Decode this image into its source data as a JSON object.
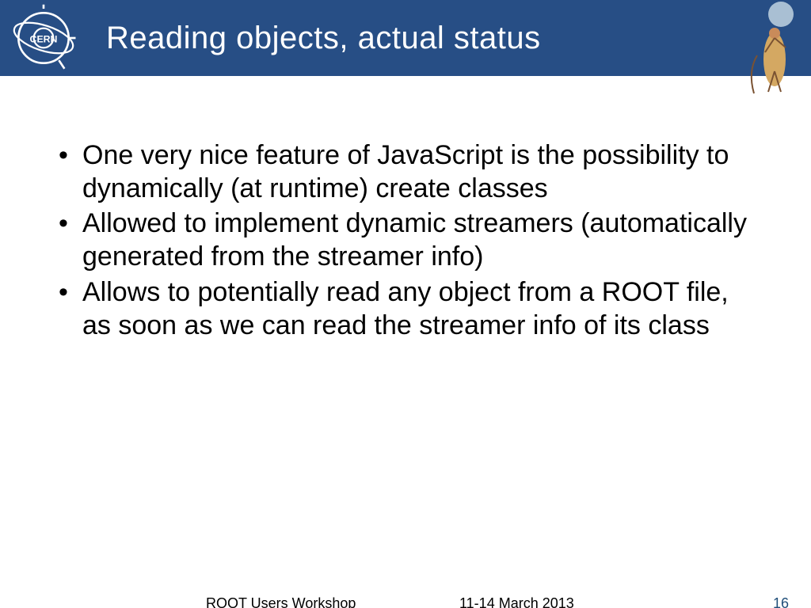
{
  "header": {
    "title": "Reading objects, actual status"
  },
  "bullets": [
    "One very nice feature of JavaScript is the possibility to dynamically (at runtime) create classes",
    "Allowed to implement dynamic streamers (automatically generated from the streamer info)",
    "Allows to potentially read any object from a ROOT file, as soon as we can read the streamer info of its class"
  ],
  "footer": {
    "event": "ROOT Users Workshop",
    "date": "11-14 March 2013",
    "page": "16"
  }
}
